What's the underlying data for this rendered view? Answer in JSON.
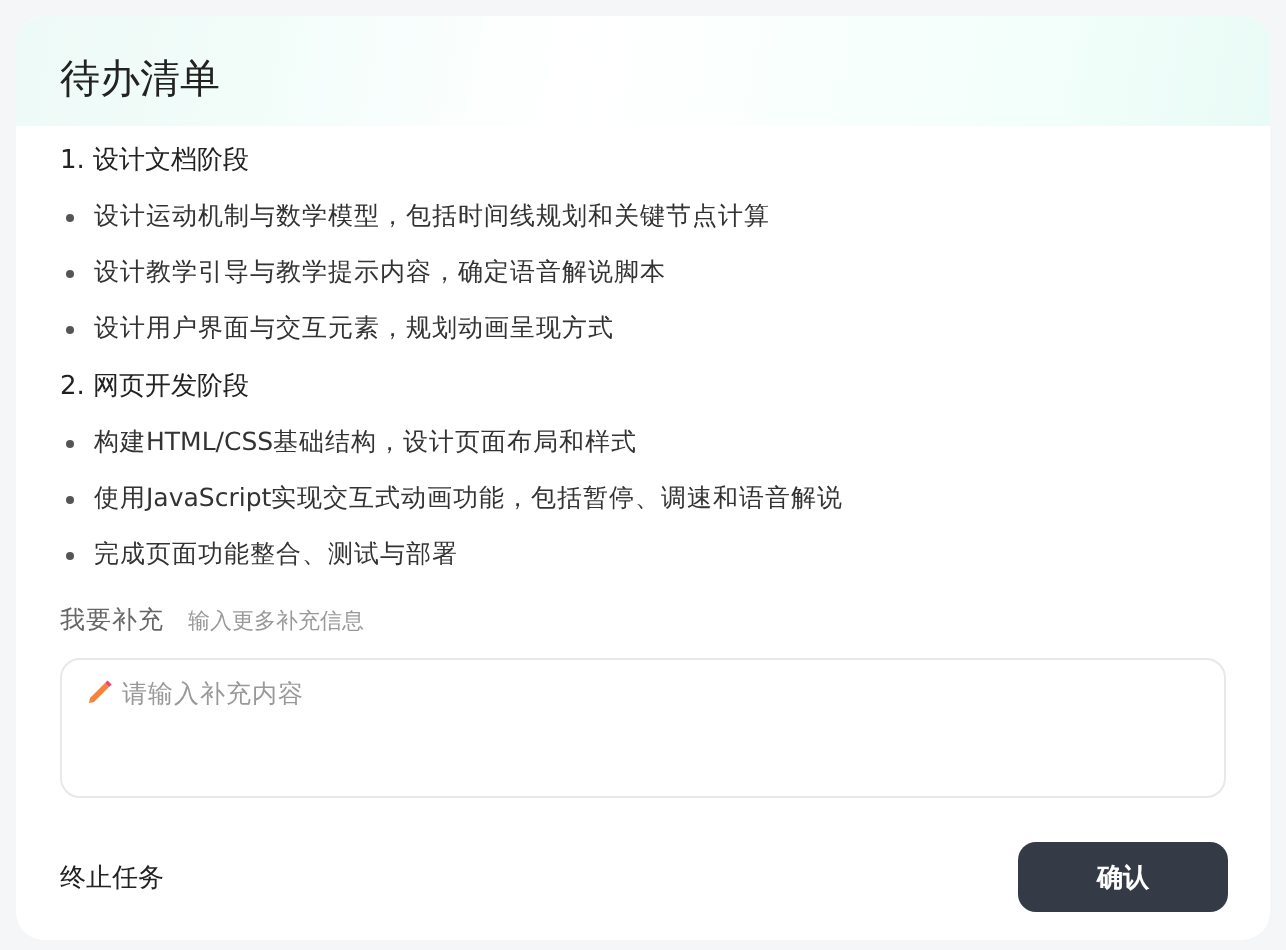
{
  "title": "待办清单",
  "sections": [
    {
      "heading": "1. 设计文档阶段",
      "items": [
        "设计运动机制与数学模型，包括时间线规划和关键节点计算",
        "设计教学引导与教学提示内容，确定语音解说脚本",
        "设计用户界面与交互元素，规划动画呈现方式"
      ]
    },
    {
      "heading": "2. 网页开发阶段",
      "items": [
        "构建HTML/CSS基础结构，设计页面布局和样式",
        "使用JavaScript实现交互式动画功能，包括暂停、调速和语音解说",
        "完成页面功能整合、测试与部署"
      ]
    }
  ],
  "supplement": {
    "label": "我要补充",
    "hint": "输入更多补充信息",
    "placeholder": "请输入补充内容"
  },
  "footer": {
    "stop": "终止任务",
    "confirm": "确认"
  }
}
